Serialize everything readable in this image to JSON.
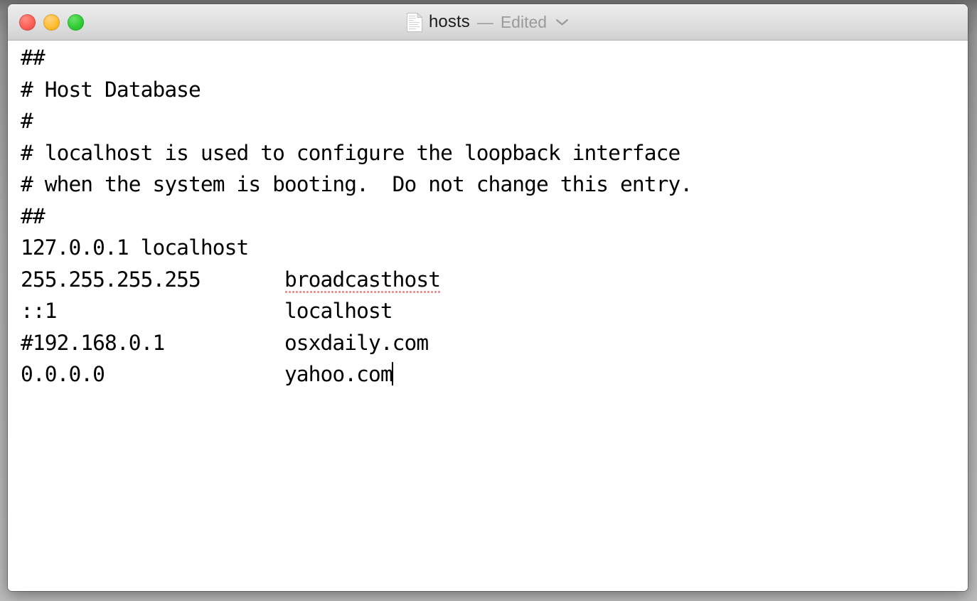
{
  "window": {
    "title_filename": "hosts",
    "title_separator": "—",
    "title_status": "Edited",
    "chevron_icon": "chevron-down-icon",
    "document_icon": "document-icon",
    "traffic_lights": [
      {
        "name": "close",
        "label": "Close",
        "color": "#fc5f55"
      },
      {
        "name": "minimize",
        "label": "Minimize",
        "color": "#ffbd2e"
      },
      {
        "name": "maximize",
        "label": "Maximize",
        "color": "#2fcc34"
      }
    ]
  },
  "document": {
    "misspelled_word": "broadcasthost",
    "misspell_underline_color": "#e98d8d",
    "caret_after_text": "yahoo.com",
    "lines": [
      {
        "text": "##"
      },
      {
        "text": "# Host Database"
      },
      {
        "text": "#"
      },
      {
        "text": "# localhost is used to configure the loopback interface"
      },
      {
        "text": "# when the system is booting.  Do not change this entry."
      },
      {
        "text": "##"
      },
      {
        "text": "127.0.0.1 localhost"
      },
      {
        "pre": "255.255.255.255",
        "gap": "       ",
        "host": "broadcasthost",
        "misspelled": true
      },
      {
        "pre": "::1",
        "gap": "                   ",
        "host": "localhost"
      },
      {
        "pre": "#192.168.0.1",
        "gap": "          ",
        "host": "osxdaily.com"
      },
      {
        "pre": "0.0.0.0",
        "gap": "               ",
        "host": "yahoo.com",
        "caret": true
      }
    ]
  }
}
